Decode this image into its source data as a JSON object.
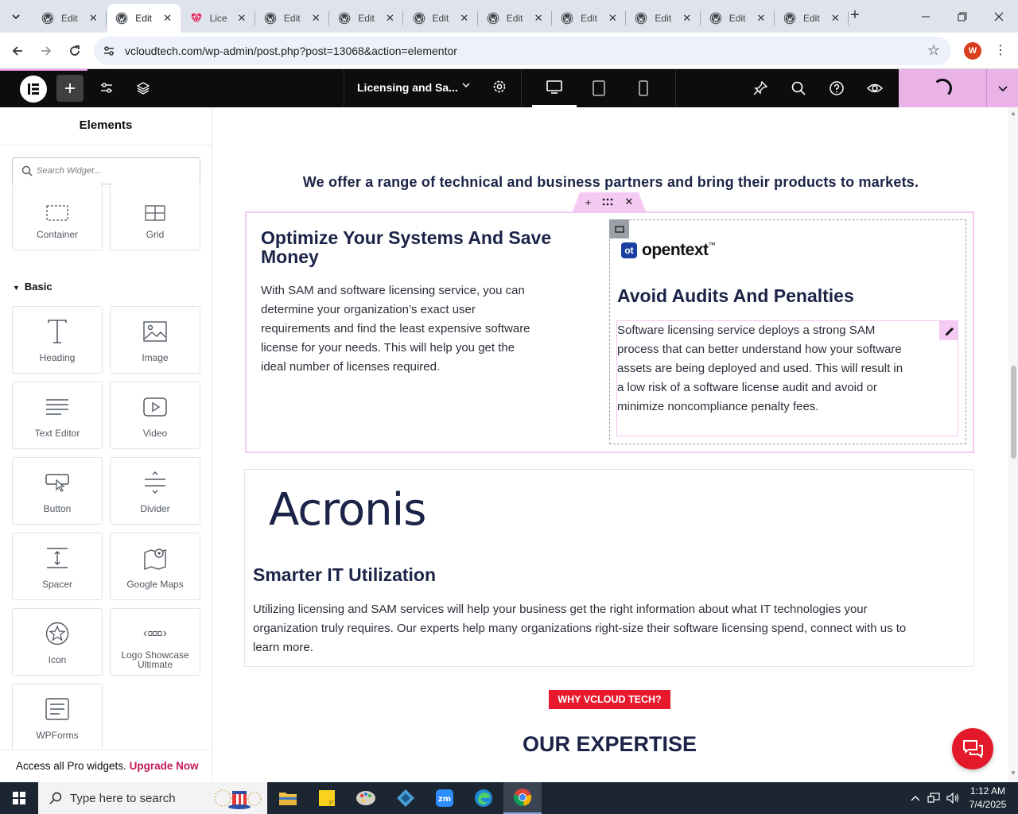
{
  "browser": {
    "tabs": [
      {
        "label": "Edit",
        "icon": "wordpress-icon",
        "active": false
      },
      {
        "label": "Edit",
        "icon": "wordpress-icon",
        "active": true
      },
      {
        "label": "Lice",
        "icon": "gem-icon",
        "active": false
      },
      {
        "label": "Edit",
        "icon": "wordpress-icon",
        "active": false
      },
      {
        "label": "Edit",
        "icon": "wordpress-icon",
        "active": false
      },
      {
        "label": "Edit",
        "icon": "wordpress-icon",
        "active": false
      },
      {
        "label": "Edit",
        "icon": "wordpress-icon",
        "active": false
      },
      {
        "label": "Edit",
        "icon": "wordpress-icon",
        "active": false
      },
      {
        "label": "Edit",
        "icon": "wordpress-icon",
        "active": false
      },
      {
        "label": "Edit",
        "icon": "wordpress-icon",
        "active": false
      },
      {
        "label": "Edit",
        "icon": "wordpress-icon",
        "active": false
      }
    ],
    "url": "vcloudtech.com/wp-admin/post.php?post=13068&action=elementor",
    "profile_initial": "W"
  },
  "editor": {
    "page_title": "Licensing and Sa...",
    "panel_title": "Elements",
    "search_placeholder": "Search Widget...",
    "layout_widgets": [
      {
        "label": "Container",
        "icon": "container-icon"
      },
      {
        "label": "Grid",
        "icon": "grid-icon"
      }
    ],
    "basic_section_label": "Basic",
    "basic_widgets": [
      {
        "label": "Heading",
        "icon": "heading-icon"
      },
      {
        "label": "Image",
        "icon": "image-icon"
      },
      {
        "label": "Text Editor",
        "icon": "text-editor-icon"
      },
      {
        "label": "Video",
        "icon": "video-icon"
      },
      {
        "label": "Button",
        "icon": "button-icon"
      },
      {
        "label": "Divider",
        "icon": "divider-icon"
      },
      {
        "label": "Spacer",
        "icon": "spacer-icon"
      },
      {
        "label": "Google Maps",
        "icon": "map-icon"
      },
      {
        "label": "Icon",
        "icon": "star-icon"
      },
      {
        "label": "Logo Showcase Ultimate",
        "icon": "logo-showcase-icon"
      },
      {
        "label": "WPForms",
        "icon": "form-icon"
      }
    ],
    "promo_text": "Access all Pro widgets.",
    "promo_link": "Upgrade Now",
    "colors": {
      "accent": "#f4c9f2",
      "publish": "#e9b3e8",
      "bar": "#0c0d0e"
    }
  },
  "page": {
    "headline": "We offer a range of technical and business partners and bring their products to markets.",
    "left_heading": "Optimize Your Systems And Save Money",
    "left_text": "With SAM and software licensing service, you can determine your organization’s exact user requirements and find the least expensive software license for your needs. This will help you get the ideal number of licenses required.",
    "partner1_logo": "opentext",
    "partner1_tm": "™",
    "right_heading": "Avoid Audits And Penalties",
    "right_text": "Software licensing service deploys a strong SAM process that can better understand how your software assets are being deployed and used. This will result in a low risk of a software license audit and avoid or minimize noncompliance penalty fees.",
    "partner2_logo": "Acronis",
    "section2_heading": "Smarter IT Utilization",
    "section2_text": "Utilizing licensing and SAM services will help your business get the right information about what IT technologies your organization truly requires. Our experts help many organizations right-size their software licensing spend, connect with us to learn more.",
    "why_badge": "WHY VCLOUD TECH?",
    "expertise_heading": "OUR EXPERTISE",
    "colors": {
      "heading": "#1b2347",
      "badge": "#e8192c"
    }
  },
  "taskbar": {
    "search_placeholder": "Type here to search",
    "time": "1:12 AM",
    "date": "7/4/2025"
  }
}
